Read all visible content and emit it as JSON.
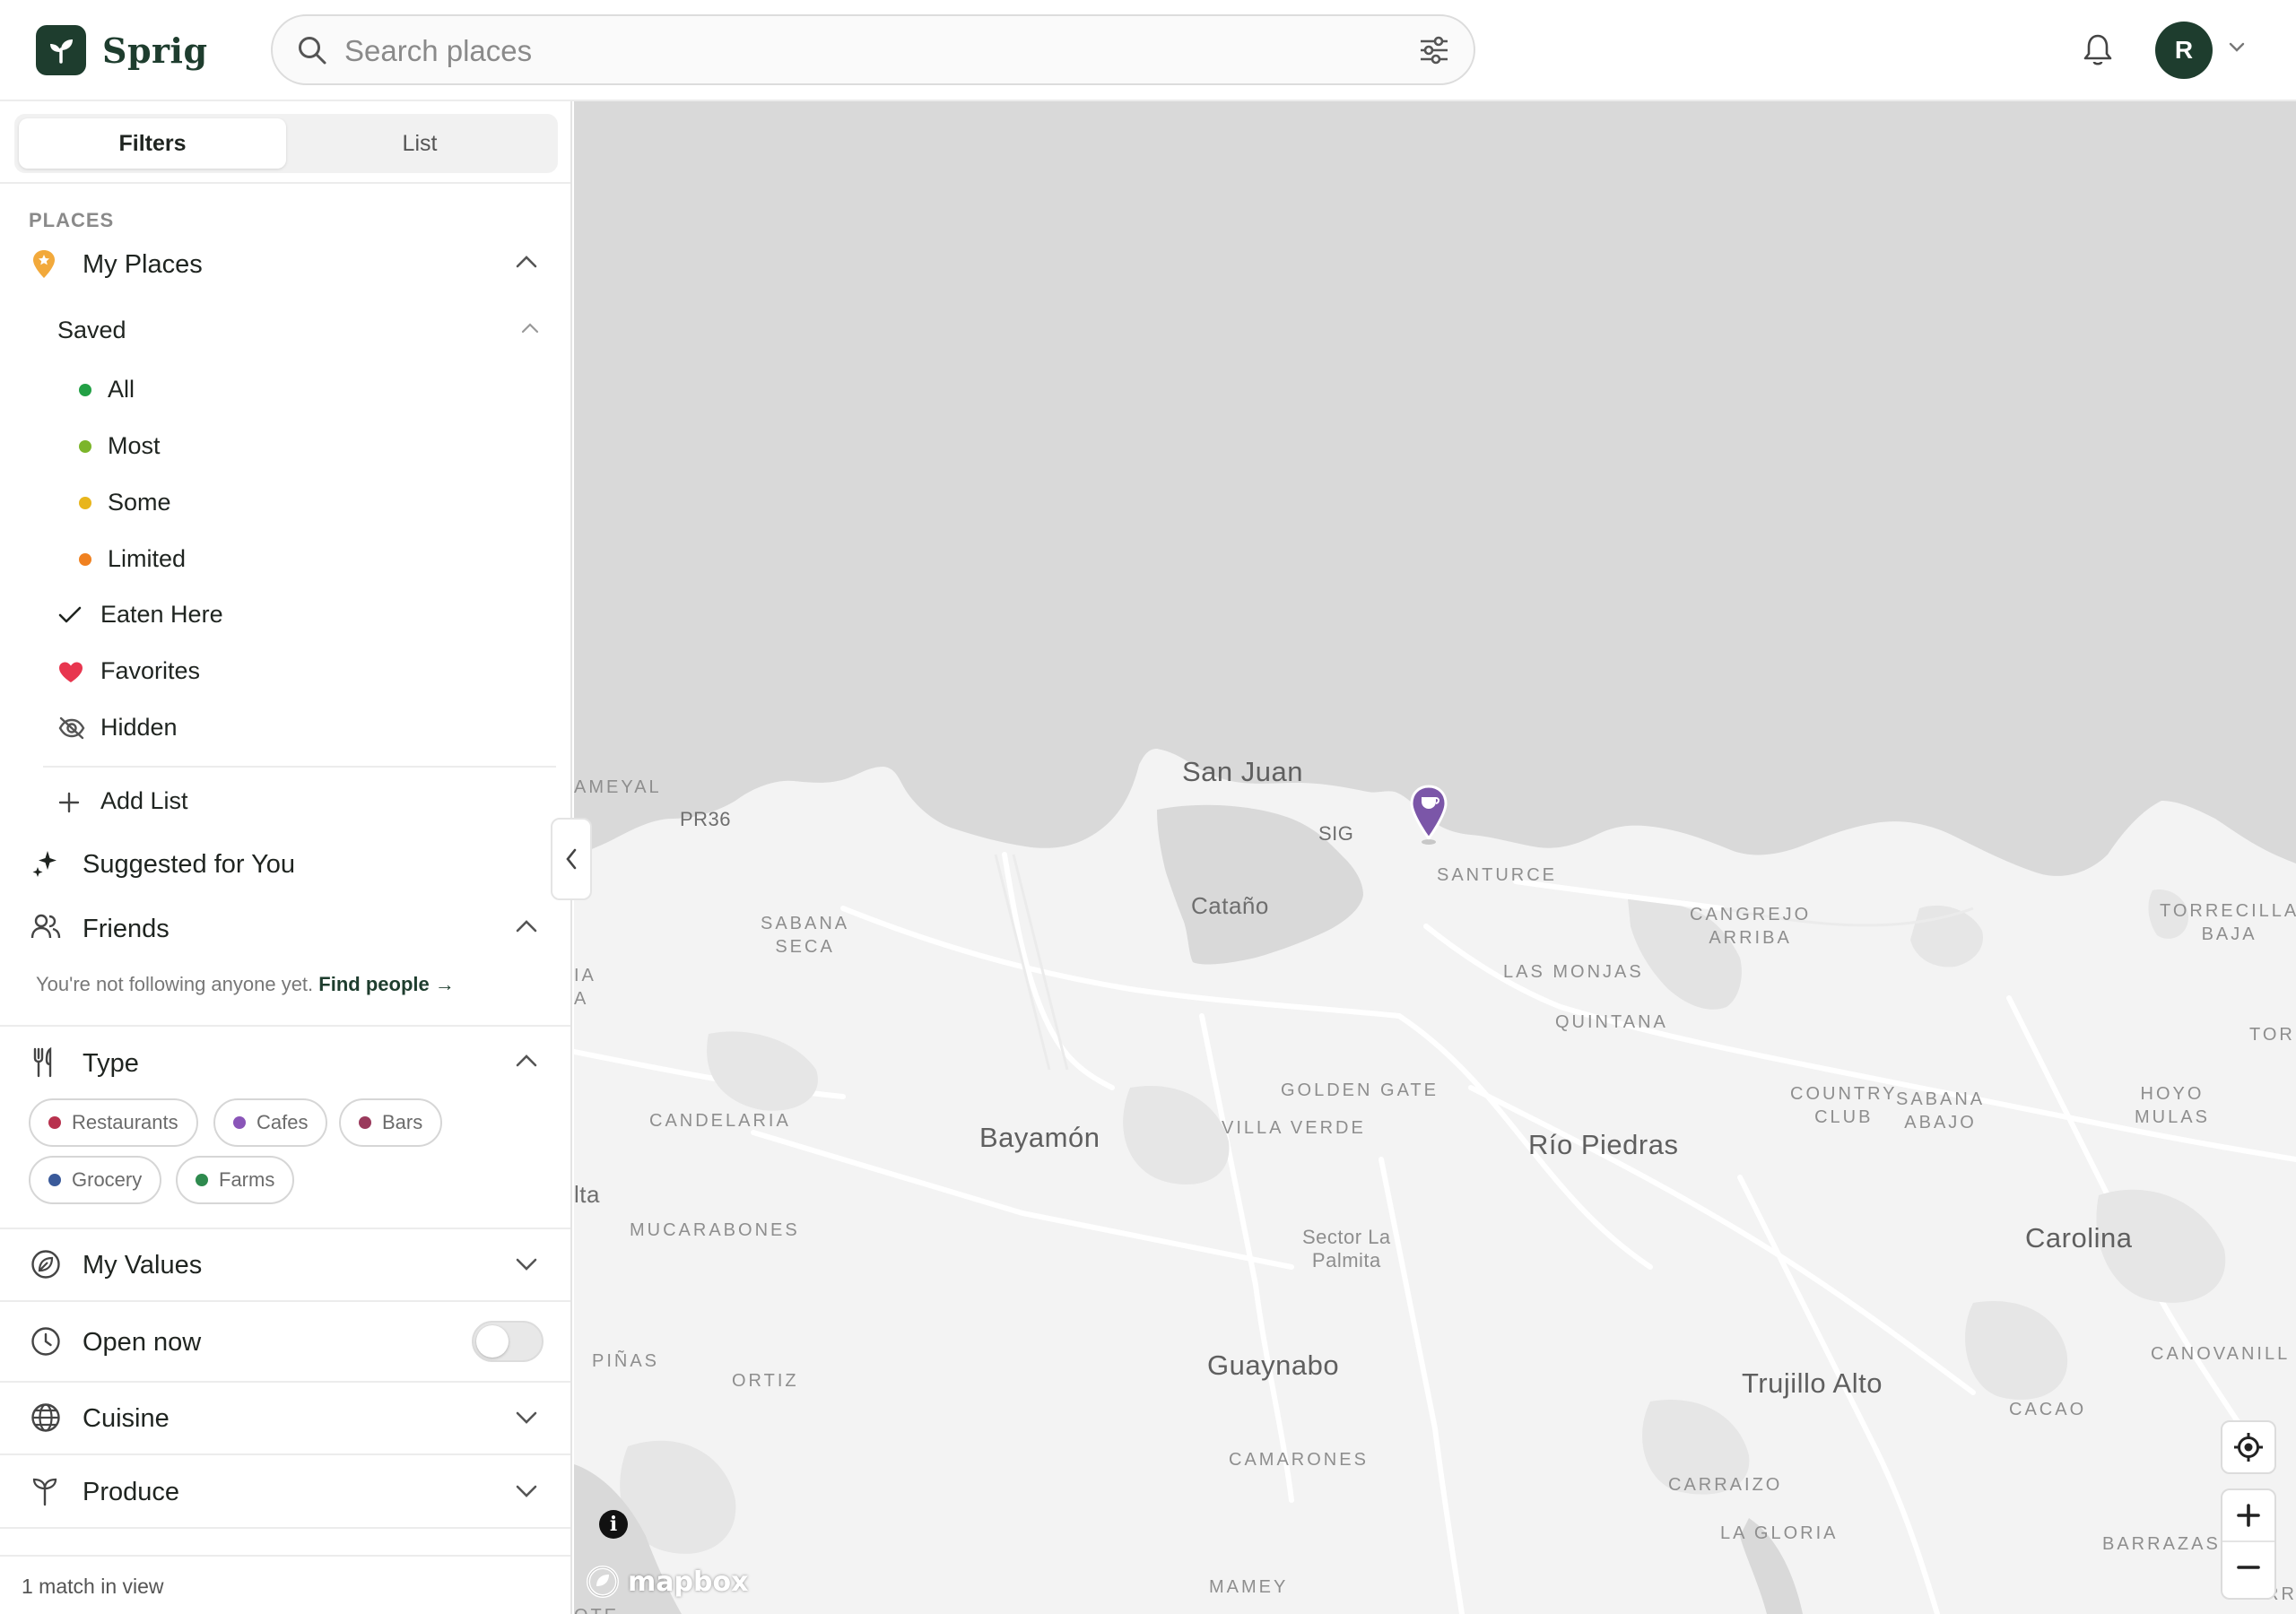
{
  "header": {
    "app_name": "Sprig",
    "search_placeholder": "Search places",
    "avatar_initial": "R"
  },
  "sidebar": {
    "tabs": [
      "Filters",
      "List"
    ],
    "section_places": "PLACES",
    "my_places": "My Places",
    "saved": "Saved",
    "saved_levels": [
      {
        "label": "All",
        "color": "#22a045"
      },
      {
        "label": "Most",
        "color": "#7cb52a"
      },
      {
        "label": "Some",
        "color": "#e8b51c"
      },
      {
        "label": "Limited",
        "color": "#f08120"
      }
    ],
    "eaten_here": "Eaten Here",
    "favorites": "Favorites",
    "hidden": "Hidden",
    "add_list": "Add List",
    "suggested": "Suggested for You",
    "friends": "Friends",
    "friends_note": "You're not following anyone yet.",
    "find_people": "Find people →",
    "type": "Type",
    "type_chips": [
      {
        "label": "Restaurants",
        "color": "#b8324e"
      },
      {
        "label": "Cafes",
        "color": "#8a55b8"
      },
      {
        "label": "Bars",
        "color": "#9a3a5c"
      },
      {
        "label": "Grocery",
        "color": "#3a5a9a"
      },
      {
        "label": "Farms",
        "color": "#2e8a4e"
      }
    ],
    "my_values": "My Values",
    "open_now": "Open now",
    "cuisine": "Cuisine",
    "produce": "Produce",
    "footer": "1 match in view"
  },
  "map": {
    "attribution": "mapbox",
    "info": "i",
    "labels": {
      "san_juan": "San Juan",
      "catano": "Cataño",
      "bayamon": "Bayamón",
      "rio_piedras": "Río Piedras",
      "guaynabo": "Guaynabo",
      "trujillo_alto": "Trujillo Alto",
      "carolina": "Carolina",
      "pr36": "PR36",
      "sig": "SIG",
      "santurce": "SANTURCE",
      "sabana_seca": "SABANA\nSECA",
      "cangrejo_arriba": "CANGREJO\nARRIBA",
      "torrecilla_baja": "TORRECILLA\nBAJA",
      "las_monjas": "LAS MONJAS",
      "quintana": "QUINTANA",
      "golden_gate": "GOLDEN GATE",
      "villa_verde": "VILLA VERDE",
      "candelaria": "CANDELARIA",
      "country_club": "COUNTRY\nCLUB",
      "sabana_abajo": "SABANA\nABAJO",
      "hoyo_mulas": "HOYO\nMULAS",
      "tor": "TOR",
      "mucarabones": "MUCARABONES",
      "sector_la_palmita": "Sector La\nPalmita",
      "pinas": "PIÑAS",
      "ortiz": "ORTIZ",
      "canovanill": "CANOVANILL",
      "cacao": "CACAO",
      "camarones": "CAMARONES",
      "carraizo": "CARRAIZO",
      "la_gloria": "LA GLORIA",
      "barrazas": "BARRAZAS",
      "mamey": "MAMEY",
      "ameyal": "AMEYAL",
      "ia_a": "IA\nA",
      "lta": "lta",
      "ote": "OTE",
      "rr": "RR"
    }
  }
}
